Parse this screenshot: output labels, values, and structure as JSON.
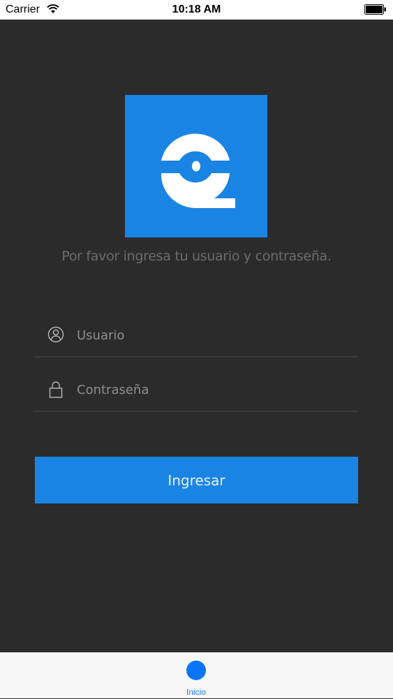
{
  "status_bar": {
    "carrier": "Carrier",
    "time": "10:18 AM",
    "wifi_icon": "wifi-icon",
    "battery_icon": "battery-icon"
  },
  "login": {
    "logo_icon": "app-logo",
    "prompt": "Por favor ingresa tu usuario y contraseña.",
    "username": {
      "icon": "user-icon",
      "placeholder": "Usuario",
      "value": ""
    },
    "password": {
      "icon": "lock-icon",
      "placeholder": "Contraseña",
      "value": ""
    },
    "submit_label": "Ingresar"
  },
  "tab_bar": {
    "items": [
      {
        "label": "Inicio",
        "icon": "home-dot-icon",
        "selected": true
      }
    ]
  },
  "colors": {
    "background": "#2b2b2c",
    "accent": "#1a84e5",
    "tab_active": "#0a76f7"
  }
}
